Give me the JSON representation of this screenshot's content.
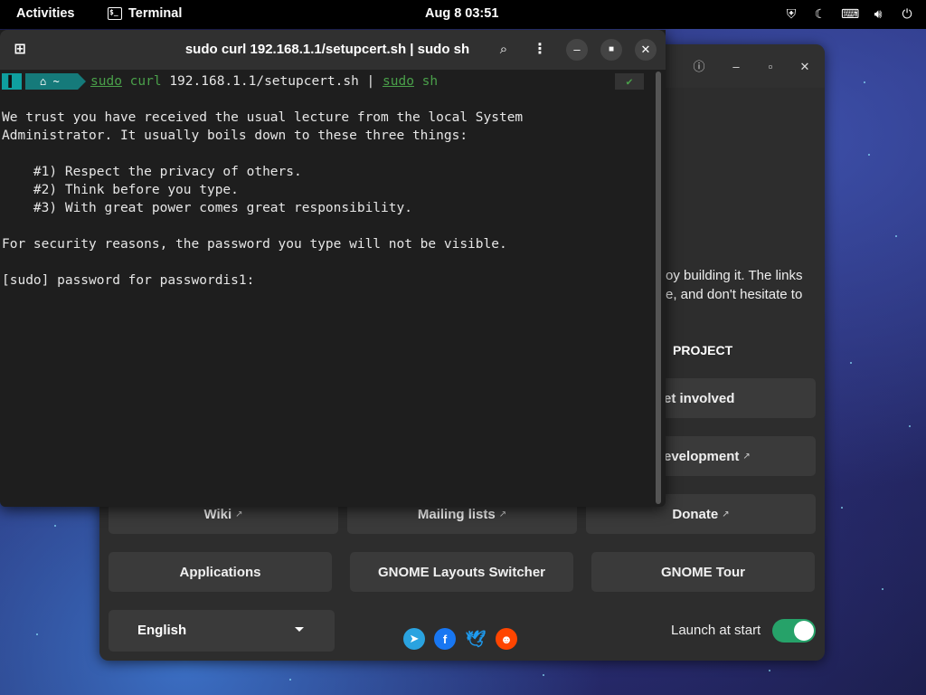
{
  "topbar": {
    "activities": "Activities",
    "app_name": "Terminal",
    "clock": "Aug 8  03:51",
    "tray_icons": [
      "shield-icon",
      "night-light-icon",
      "keyboard-icon",
      "volume-icon",
      "power-icon"
    ]
  },
  "terminal": {
    "title": "sudo curl 192.168.1.1/setupcert.sh | sudo sh",
    "prompt_segment_home": "~",
    "command_parts": [
      "sudo",
      " curl ",
      "192.168.1.1/setupcert.sh | ",
      "sudo",
      " sh"
    ],
    "status_check": "✔",
    "output": "We trust you have received the usual lecture from the local System\nAdministrator. It usually boils down to these three things:\n\n    #1) Respect the privacy of others.\n    #2) Think before you type.\n    #3) With great power comes great responsibility.\n\nFor security reasons, the password you type will not be visible.\n\n[sudo] password for passwordis1:"
  },
  "welcome": {
    "partial_line_1": "oy building it. The links",
    "partial_line_2": "e, and don't hesitate to",
    "section_heading": "PROJECT",
    "buttons": {
      "get_involved": "et involved",
      "development": "evelopment",
      "wiki": "Wiki",
      "mailing_lists": "Mailing lists",
      "donate": "Donate",
      "applications": "Applications",
      "layouts_switcher": "GNOME Layouts Switcher",
      "tour": "GNOME Tour"
    },
    "language": "English",
    "launch_at_start": "Launch at start",
    "launch_toggle_on": true,
    "socials": [
      "telegram-icon",
      "facebook-icon",
      "twitter-icon",
      "reddit-icon"
    ],
    "colors": {
      "toggle": "#26a269",
      "telegram": "#2aa3e0",
      "facebook": "#1877f2",
      "twitter": "#1d9bf0",
      "reddit": "#ff4500"
    }
  }
}
